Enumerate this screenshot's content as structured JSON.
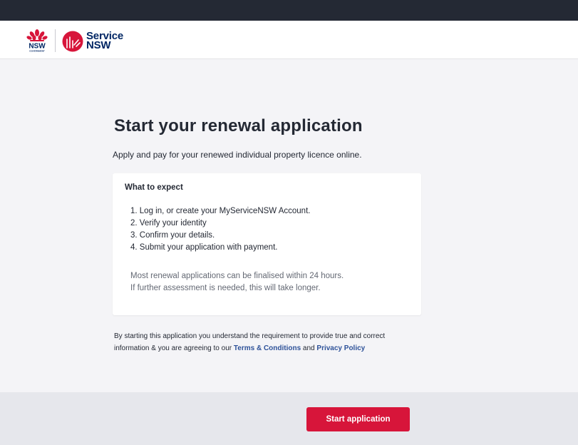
{
  "header": {
    "nsw_logo_text": "NSW",
    "nsw_logo_subtext": "GOVERNMENT",
    "service_logo_line1": "Service",
    "service_logo_line2": "NSW"
  },
  "main": {
    "title": "Start your renewal application",
    "intro": "Apply and pay for your renewed individual property licence online.",
    "card": {
      "title": "What to expect",
      "steps": [
        "1. Log in, or create your MyServiceNSW Account.",
        "2. Verify your identity",
        "3. Confirm your details.",
        "4. Submit your application with payment."
      ],
      "note_line1": "Most renewal applications can be finalised within 24 hours.",
      "note_line2": "If further assessment is needed, this will take longer."
    },
    "terms": {
      "prefix": "By starting this application you understand the requirement to provide true and correct information & you are agreeing to our ",
      "link1": "Terms & Conditions",
      "middle": " and ",
      "link2": "Privacy Policy"
    }
  },
  "footer": {
    "start_button_label": "Start application"
  },
  "colors": {
    "topbar": "#242934",
    "brand_navy": "#002664",
    "brand_red": "#d7153a",
    "link": "#2e5299"
  }
}
